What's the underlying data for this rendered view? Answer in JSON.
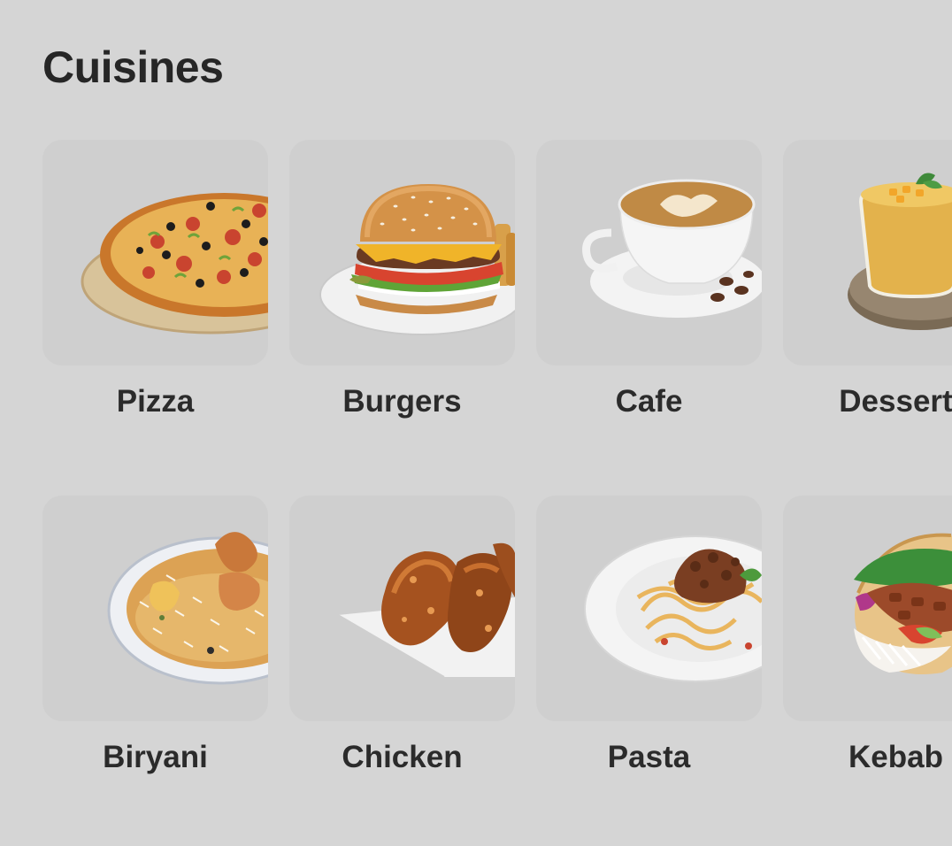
{
  "header": {
    "title": "Cuisines"
  },
  "cuisines": [
    {
      "label": "Pizza",
      "icon": "pizza-image"
    },
    {
      "label": "Burgers",
      "icon": "burger-image"
    },
    {
      "label": "Cafe",
      "icon": "coffee-cup-image"
    },
    {
      "label": "Dessert",
      "icon": "dessert-glass-image"
    },
    {
      "label": "Biryani",
      "icon": "biryani-plate-image"
    },
    {
      "label": "Chicken",
      "icon": "chicken-wings-image"
    },
    {
      "label": "Pasta",
      "icon": "pasta-plate-image"
    },
    {
      "label": "Kebab",
      "icon": "kebab-wrap-image"
    }
  ]
}
